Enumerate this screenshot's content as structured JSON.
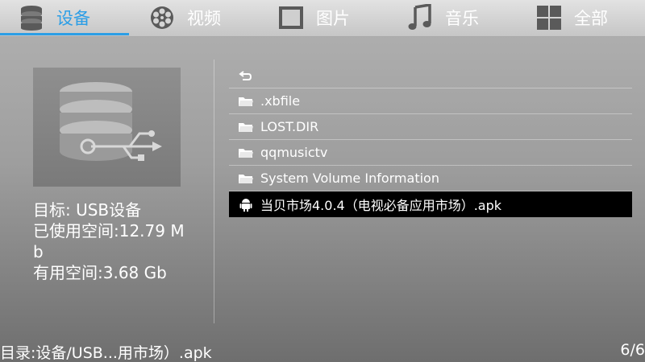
{
  "tabs": [
    {
      "label": "设备",
      "icon": "storage-icon",
      "active": true
    },
    {
      "label": "视频",
      "icon": "film-reel-icon",
      "active": false
    },
    {
      "label": "图片",
      "icon": "picture-frame-icon",
      "active": false
    },
    {
      "label": "音乐",
      "icon": "music-note-icon",
      "active": false
    },
    {
      "label": "全部",
      "icon": "grid-icon",
      "active": false
    }
  ],
  "device": {
    "icon": "usb-database-icon",
    "target": "目标: USB设备",
    "used": "已使用空间:12.79 Mb",
    "free": "有用空间:3.68 Gb"
  },
  "files": [
    {
      "label": "",
      "icon": "back-arrow-icon",
      "selected": false
    },
    {
      "label": ".xbfile",
      "icon": "folder-icon",
      "selected": false
    },
    {
      "label": "LOST.DIR",
      "icon": "folder-icon",
      "selected": false
    },
    {
      "label": "qqmusictv",
      "icon": "folder-icon",
      "selected": false
    },
    {
      "label": "System Volume Information",
      "icon": "folder-icon",
      "selected": false
    },
    {
      "label": "当贝市场4.0.4（电视必备应用市场）.apk",
      "icon": "android-icon",
      "selected": true
    }
  ],
  "status": {
    "path": "目录:设备/USB...用市场）.apk",
    "page": "6/6"
  },
  "colors": {
    "accent": "#2c9ee6",
    "selected_row": "#000000"
  }
}
